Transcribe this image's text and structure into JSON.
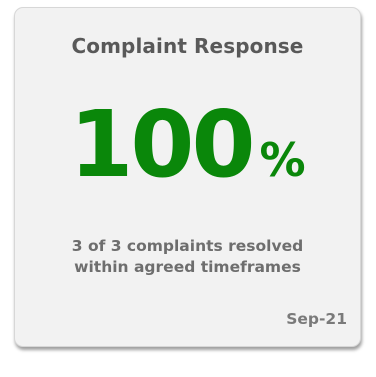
{
  "card": {
    "title": "Complaint Response",
    "metric": {
      "value": "100",
      "unit": "%",
      "percent": 100
    },
    "description": {
      "line1": "3 of 3 complaints resolved",
      "line2": "within agreed timeframes"
    },
    "date": "Sep-21"
  },
  "colors": {
    "accent": "#0a870a",
    "title_text": "#595959",
    "body_text": "#6e6e6e",
    "card_background": "#f2f2f2"
  }
}
